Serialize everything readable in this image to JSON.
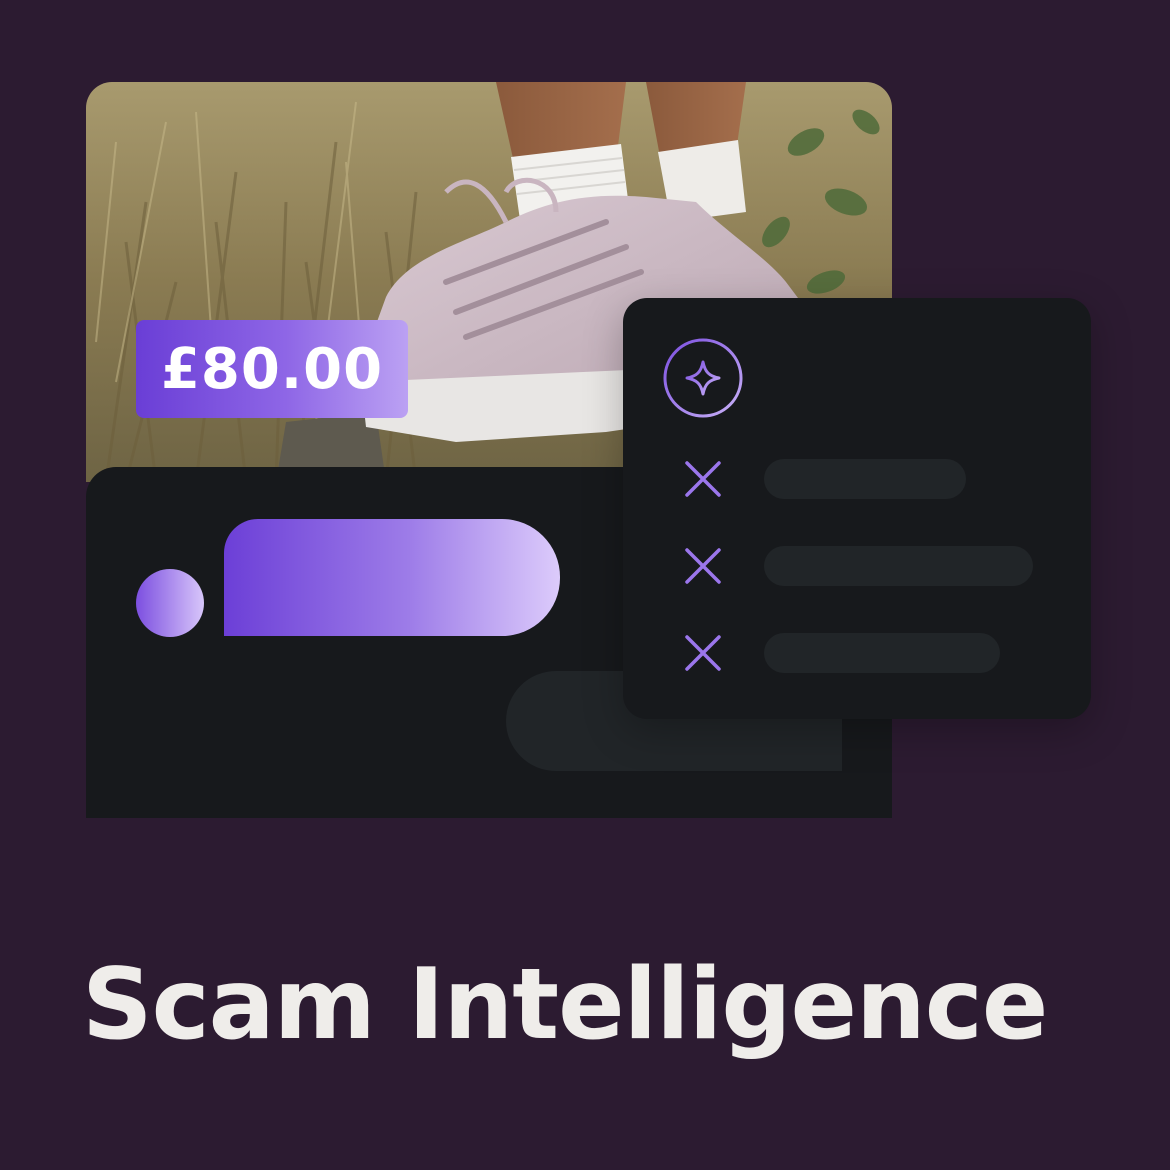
{
  "price_tag": {
    "amount": "£80.00"
  },
  "feature": {
    "title": "Scam Intelligence"
  },
  "colors": {
    "background": "#2c1b31",
    "panel": "#17191c",
    "placeholder": "#212528",
    "accent_start": "#6a3ed6",
    "accent_end": "#dccbfb",
    "title_text": "#efedea"
  },
  "icons": {
    "badge": "sparkle-icon",
    "checks": [
      "x-mark-icon",
      "x-mark-icon",
      "x-mark-icon"
    ]
  }
}
